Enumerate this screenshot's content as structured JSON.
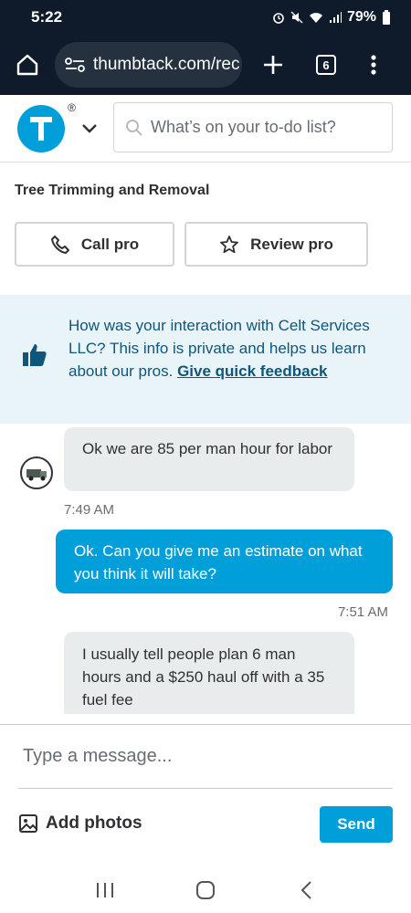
{
  "status_bar": {
    "time": "5:22",
    "battery": "79%",
    "icons": [
      "alarm-icon",
      "mute-icon",
      "wifi-icon",
      "signal-icon",
      "battery-icon"
    ]
  },
  "browser": {
    "url": "thumbtack.com/rec",
    "tab_count": "6"
  },
  "header": {
    "logo_mark": "®",
    "search_placeholder": "What’s on your to-do list?"
  },
  "service": {
    "title": "Tree Trimming and Removal",
    "call_label": "Call pro",
    "review_label": "Review pro"
  },
  "feedback": {
    "text": "How was your interaction with Celt Services LLC? This info is private and helps us learn about our pros. ",
    "link": "Give quick feedback"
  },
  "messages": [
    {
      "direction": "incoming",
      "text": "Ok we are 85 per man hour for labor",
      "time": "7:49 AM"
    },
    {
      "direction": "outgoing",
      "text": "Ok. Can you give me an estimate on what you think it will take?",
      "time": "7:51 AM"
    },
    {
      "direction": "incoming",
      "text": "I usually tell people plan 6 man hours and a $250 haul off with a 35 fuel fee",
      "time": ""
    }
  ],
  "composer": {
    "placeholder": "Type a message...",
    "add_photos_label": "Add photos",
    "send_label": "Send"
  },
  "colors": {
    "brand": "#009fd9",
    "chrome": "#0f1b2a",
    "banner_bg": "#e9f4f9",
    "banner_text": "#10567a"
  }
}
